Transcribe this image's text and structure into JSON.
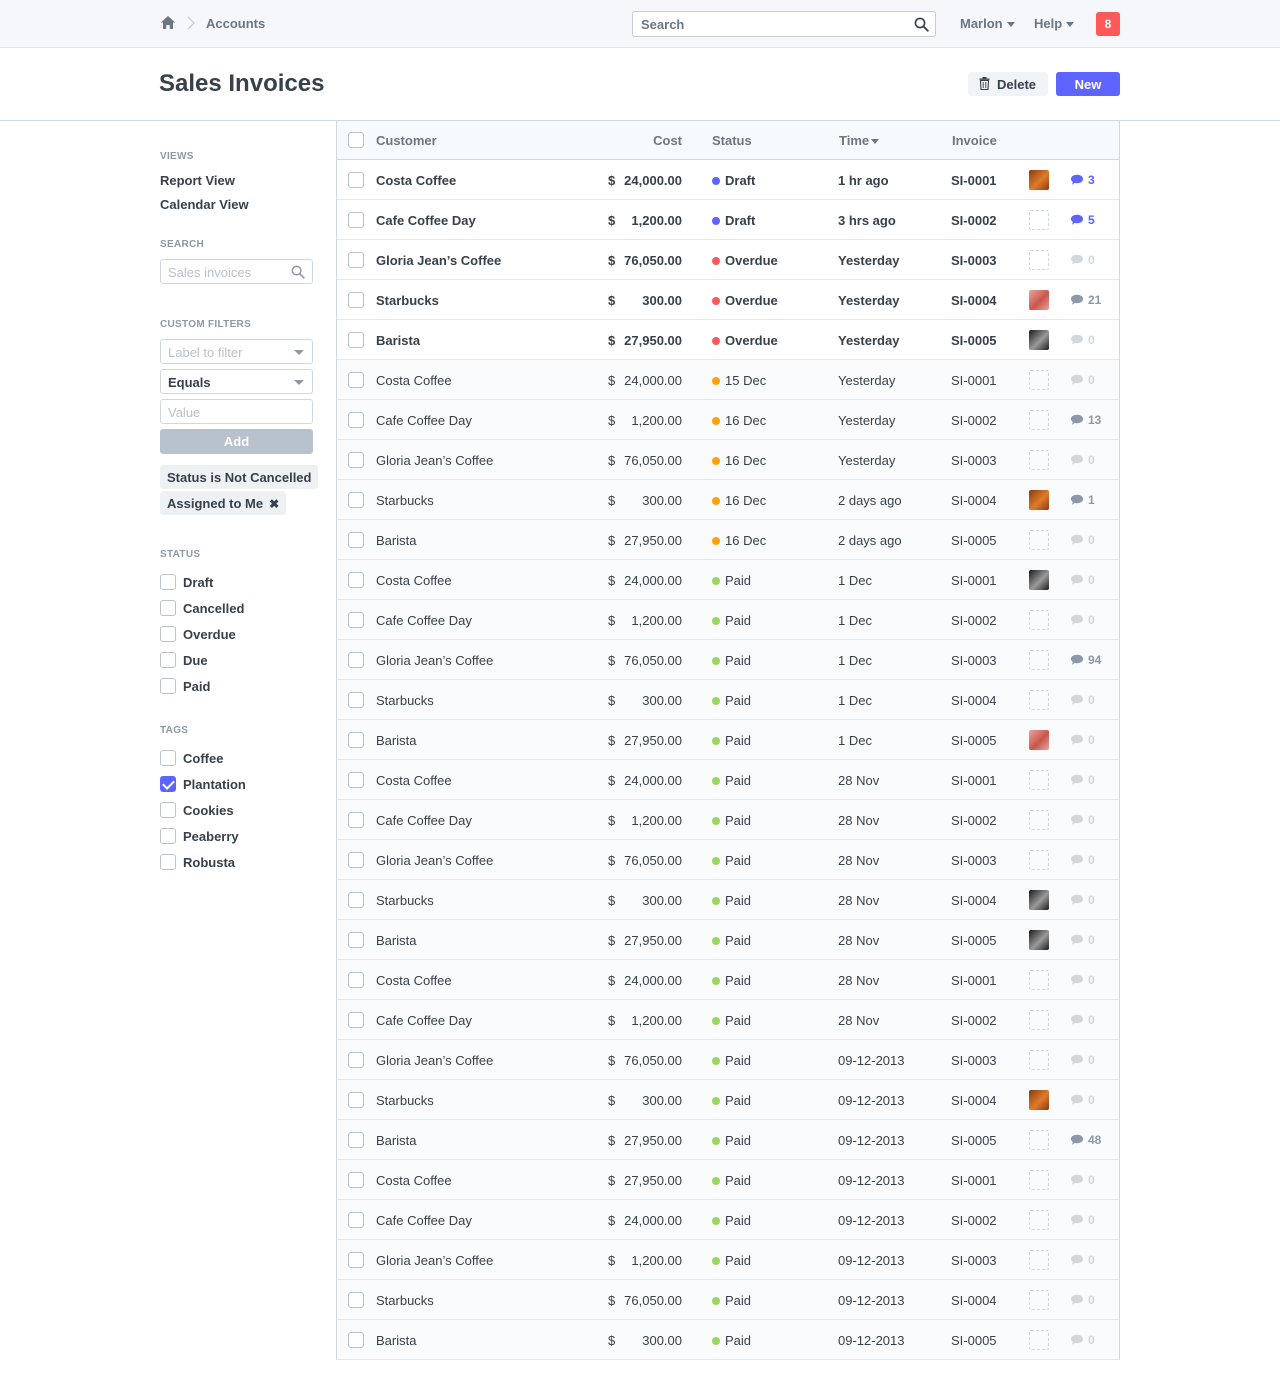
{
  "navbar": {
    "breadcrumb": "Accounts",
    "search_placeholder": "Search",
    "user": "Marlon",
    "help": "Help",
    "notifications": "8"
  },
  "page": {
    "title": "Sales Invoices",
    "delete_label": "Delete",
    "new_label": "New"
  },
  "sidebar": {
    "views_heading": "VIEWS",
    "views": [
      "Report View",
      "Calendar View"
    ],
    "search_heading": "SEARCH",
    "search_placeholder": "Sales invoices",
    "filters_heading": "CUSTOM FILTERS",
    "filter_label_placeholder": "Label to filter",
    "filter_operator": "Equals",
    "filter_value_placeholder": "Value",
    "add_label": "Add",
    "active_filters": [
      "Status is Not Cancelled",
      "Assigned to Me"
    ],
    "status_heading": "STATUS",
    "statuses": [
      {
        "label": "Draft",
        "checked": false
      },
      {
        "label": "Cancelled",
        "checked": false
      },
      {
        "label": "Overdue",
        "checked": false
      },
      {
        "label": "Due",
        "checked": false
      },
      {
        "label": "Paid",
        "checked": false
      }
    ],
    "tags_heading": "TAGS",
    "tags": [
      {
        "label": "Coffee",
        "checked": false
      },
      {
        "label": "Plantation",
        "checked": true
      },
      {
        "label": "Cookies",
        "checked": false
      },
      {
        "label": "Peaberry",
        "checked": false
      },
      {
        "label": "Robusta",
        "checked": false
      }
    ]
  },
  "colors": {
    "draft": "#5e64ff",
    "overdue": "#ff5858",
    "due": "#ffa00a",
    "paid": "#98d85b",
    "accent": "#5e64ff"
  },
  "table": {
    "headers": {
      "customer": "Customer",
      "cost": "Cost",
      "status": "Status",
      "time": "Time",
      "invoice": "Invoice"
    },
    "currency": "$",
    "rows": [
      {
        "customer": "Costa Coffee",
        "cost": "24,000.00",
        "status": "Draft",
        "status_color": "draft",
        "time": "1 hr ago",
        "invoice": "SI-0001",
        "avatar": "orange",
        "comments": "3",
        "unread": true,
        "comment_active": true
      },
      {
        "customer": "Cafe Coffee Day",
        "cost": "1,200.00",
        "status": "Draft",
        "status_color": "draft",
        "time": "3 hrs ago",
        "invoice": "SI-0002",
        "avatar": "",
        "comments": "5",
        "unread": true,
        "comment_active": true
      },
      {
        "customer": "Gloria Jean’s Coffee",
        "cost": "76,050.00",
        "status": "Overdue",
        "status_color": "overdue",
        "time": "Yesterday",
        "invoice": "SI-0003",
        "avatar": "",
        "comments": "0",
        "unread": true,
        "comment_active": false
      },
      {
        "customer": "Starbucks",
        "cost": "300.00",
        "status": "Overdue",
        "status_color": "overdue",
        "time": "Yesterday",
        "invoice": "SI-0004",
        "avatar": "pink",
        "comments": "21",
        "unread": true,
        "comment_active": false
      },
      {
        "customer": "Barista",
        "cost": "27,950.00",
        "status": "Overdue",
        "status_color": "overdue",
        "time": "Yesterday",
        "invoice": "SI-0005",
        "avatar": "dark",
        "comments": "0",
        "unread": true,
        "comment_active": false
      },
      {
        "customer": "Costa Coffee",
        "cost": "24,000.00",
        "status": "15 Dec",
        "status_color": "due",
        "time": "Yesterday",
        "invoice": "SI-0001",
        "avatar": "",
        "comments": "0",
        "unread": false,
        "comment_active": false
      },
      {
        "customer": "Cafe Coffee Day",
        "cost": "1,200.00",
        "status": "16 Dec",
        "status_color": "due",
        "time": "Yesterday",
        "invoice": "SI-0002",
        "avatar": "",
        "comments": "13",
        "unread": false,
        "comment_active": false
      },
      {
        "customer": "Gloria Jean’s Coffee",
        "cost": "76,050.00",
        "status": "16 Dec",
        "status_color": "due",
        "time": "Yesterday",
        "invoice": "SI-0003",
        "avatar": "",
        "comments": "0",
        "unread": false,
        "comment_active": false
      },
      {
        "customer": "Starbucks",
        "cost": "300.00",
        "status": "16 Dec",
        "status_color": "due",
        "time": "2 days ago",
        "invoice": "SI-0004",
        "avatar": "orange",
        "comments": "1",
        "unread": false,
        "comment_active": false
      },
      {
        "customer": "Barista",
        "cost": "27,950.00",
        "status": "16 Dec",
        "status_color": "due",
        "time": "2 days ago",
        "invoice": "SI-0005",
        "avatar": "",
        "comments": "0",
        "unread": false,
        "comment_active": false
      },
      {
        "customer": "Costa Coffee",
        "cost": "24,000.00",
        "status": "Paid",
        "status_color": "paid",
        "time": "1 Dec",
        "invoice": "SI-0001",
        "avatar": "dark",
        "comments": "0",
        "unread": false,
        "comment_active": false
      },
      {
        "customer": "Cafe Coffee Day",
        "cost": "1,200.00",
        "status": "Paid",
        "status_color": "paid",
        "time": "1 Dec",
        "invoice": "SI-0002",
        "avatar": "",
        "comments": "0",
        "unread": false,
        "comment_active": false
      },
      {
        "customer": "Gloria Jean’s Coffee",
        "cost": "76,050.00",
        "status": "Paid",
        "status_color": "paid",
        "time": "1 Dec",
        "invoice": "SI-0003",
        "avatar": "",
        "comments": "94",
        "unread": false,
        "comment_active": false
      },
      {
        "customer": "Starbucks",
        "cost": "300.00",
        "status": "Paid",
        "status_color": "paid",
        "time": "1 Dec",
        "invoice": "SI-0004",
        "avatar": "",
        "comments": "0",
        "unread": false,
        "comment_active": false
      },
      {
        "customer": "Barista",
        "cost": "27,950.00",
        "status": "Paid",
        "status_color": "paid",
        "time": "1 Dec",
        "invoice": "SI-0005",
        "avatar": "pink",
        "comments": "0",
        "unread": false,
        "comment_active": false
      },
      {
        "customer": "Costa Coffee",
        "cost": "24,000.00",
        "status": "Paid",
        "status_color": "paid",
        "time": "28 Nov",
        "invoice": "SI-0001",
        "avatar": "",
        "comments": "0",
        "unread": false,
        "comment_active": false
      },
      {
        "customer": "Cafe Coffee Day",
        "cost": "1,200.00",
        "status": "Paid",
        "status_color": "paid",
        "time": "28 Nov",
        "invoice": "SI-0002",
        "avatar": "",
        "comments": "0",
        "unread": false,
        "comment_active": false
      },
      {
        "customer": "Gloria Jean’s Coffee",
        "cost": "76,050.00",
        "status": "Paid",
        "status_color": "paid",
        "time": "28 Nov",
        "invoice": "SI-0003",
        "avatar": "",
        "comments": "0",
        "unread": false,
        "comment_active": false
      },
      {
        "customer": "Starbucks",
        "cost": "300.00",
        "status": "Paid",
        "status_color": "paid",
        "time": "28 Nov",
        "invoice": "SI-0004",
        "avatar": "dark",
        "comments": "0",
        "unread": false,
        "comment_active": false
      },
      {
        "customer": "Barista",
        "cost": "27,950.00",
        "status": "Paid",
        "status_color": "paid",
        "time": "28 Nov",
        "invoice": "SI-0005",
        "avatar": "dark",
        "comments": "0",
        "unread": false,
        "comment_active": false
      },
      {
        "customer": "Costa Coffee",
        "cost": "24,000.00",
        "status": "Paid",
        "status_color": "paid",
        "time": "28 Nov",
        "invoice": "SI-0001",
        "avatar": "",
        "comments": "0",
        "unread": false,
        "comment_active": false
      },
      {
        "customer": "Cafe Coffee Day",
        "cost": "1,200.00",
        "status": "Paid",
        "status_color": "paid",
        "time": "28 Nov",
        "invoice": "SI-0002",
        "avatar": "",
        "comments": "0",
        "unread": false,
        "comment_active": false
      },
      {
        "customer": "Gloria Jean’s Coffee",
        "cost": "76,050.00",
        "status": "Paid",
        "status_color": "paid",
        "time": "09-12-2013",
        "invoice": "SI-0003",
        "avatar": "",
        "comments": "0",
        "unread": false,
        "comment_active": false
      },
      {
        "customer": "Starbucks",
        "cost": "300.00",
        "status": "Paid",
        "status_color": "paid",
        "time": "09-12-2013",
        "invoice": "SI-0004",
        "avatar": "orange",
        "comments": "0",
        "unread": false,
        "comment_active": false
      },
      {
        "customer": "Barista",
        "cost": "27,950.00",
        "status": "Paid",
        "status_color": "paid",
        "time": "09-12-2013",
        "invoice": "SI-0005",
        "avatar": "",
        "comments": "48",
        "unread": false,
        "comment_active": false
      },
      {
        "customer": "Costa Coffee",
        "cost": "27,950.00",
        "status": "Paid",
        "status_color": "paid",
        "time": "09-12-2013",
        "invoice": "SI-0001",
        "avatar": "",
        "comments": "0",
        "unread": false,
        "comment_active": false
      },
      {
        "customer": "Cafe Coffee Day",
        "cost": "24,000.00",
        "status": "Paid",
        "status_color": "paid",
        "time": "09-12-2013",
        "invoice": "SI-0002",
        "avatar": "",
        "comments": "0",
        "unread": false,
        "comment_active": false
      },
      {
        "customer": "Gloria Jean’s Coffee",
        "cost": "1,200.00",
        "status": "Paid",
        "status_color": "paid",
        "time": "09-12-2013",
        "invoice": "SI-0003",
        "avatar": "",
        "comments": "0",
        "unread": false,
        "comment_active": false
      },
      {
        "customer": "Starbucks",
        "cost": "76,050.00",
        "status": "Paid",
        "status_color": "paid",
        "time": "09-12-2013",
        "invoice": "SI-0004",
        "avatar": "",
        "comments": "0",
        "unread": false,
        "comment_active": false
      },
      {
        "customer": "Barista",
        "cost": "300.00",
        "status": "Paid",
        "status_color": "paid",
        "time": "09-12-2013",
        "invoice": "SI-0005",
        "avatar": "",
        "comments": "0",
        "unread": false,
        "comment_active": false
      }
    ]
  }
}
